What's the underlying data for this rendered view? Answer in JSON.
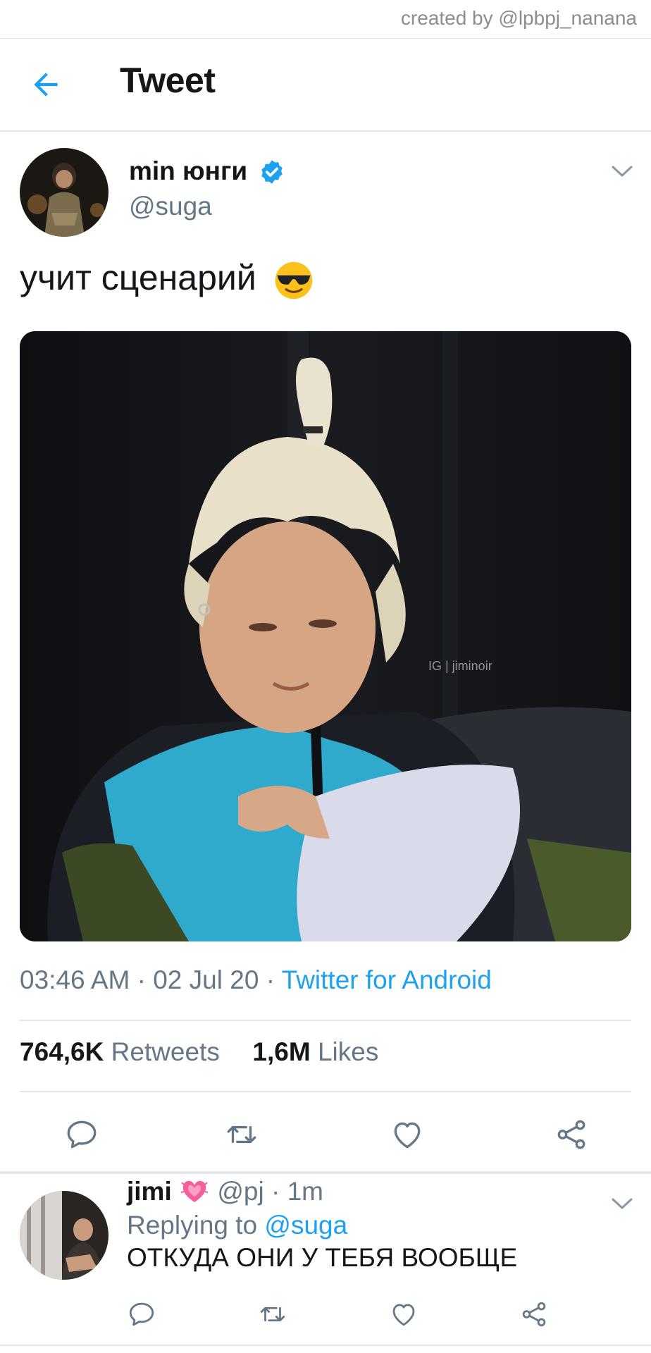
{
  "watermark": "created by @lpbpj_nanana",
  "header": {
    "title": "Tweet",
    "back_icon": "arrow-left-icon"
  },
  "colors": {
    "accent": "#1da1f2",
    "secondary_text": "#657786",
    "divider": "#e1e6ea"
  },
  "tweet": {
    "author_name": "min юнги",
    "verified": true,
    "handle": "@suga",
    "text": "учит сценарий",
    "emoji": "smiling-face-with-sunglasses",
    "image_watermark": "IG | jiminoir",
    "time": "03:46 AM",
    "date": "02 Jul 20",
    "separator": "·",
    "source": "Twitter for Android",
    "retweets_count": "764,6K",
    "retweets_label": "Retweets",
    "likes_count": "1,6M",
    "likes_label": "Likes",
    "actions": [
      "reply-icon",
      "retweet-icon",
      "like-icon",
      "share-icon"
    ]
  },
  "reply": {
    "author_name": "jimi",
    "emoji": "growing-heart",
    "handle": "@pj",
    "age": "1m",
    "replying_prefix": "Replying to",
    "replying_to": "@suga",
    "text": "ОТКУДА ОНИ У ТЕБЯ ВООБЩЕ",
    "actions": [
      "reply-icon",
      "retweet-icon",
      "like-icon",
      "share-icon"
    ]
  }
}
